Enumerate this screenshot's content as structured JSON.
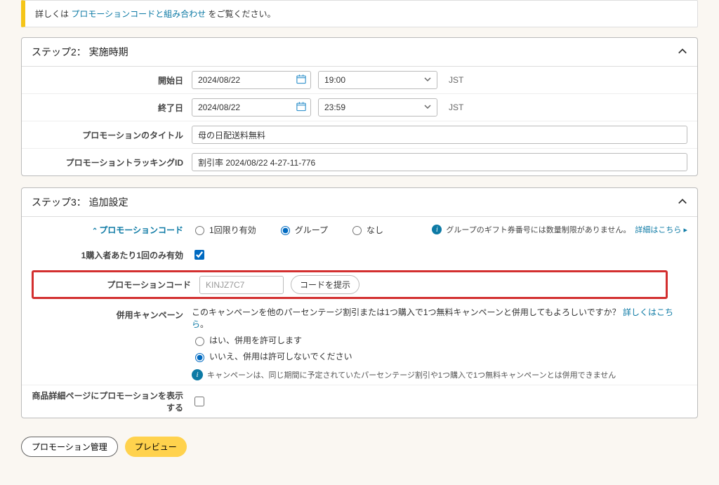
{
  "notice": {
    "prefix": "詳しくは ",
    "link": "プロモーションコードと組み合わせ",
    "suffix": " をご覧ください。"
  },
  "step2": {
    "title": "ステップ2： 実施時期",
    "rows": {
      "startDate": {
        "label": "開始日",
        "date": "2024/08/22",
        "time": "19:00",
        "tz": "JST"
      },
      "endDate": {
        "label": "終了日",
        "date": "2024/08/22",
        "time": "23:59",
        "tz": "JST"
      },
      "title": {
        "label": "プロモーションのタイトル",
        "value": "母の日配送料無料"
      },
      "trackingId": {
        "label": "プロモーショントラッキングID",
        "value": "割引率 2024/08/22 4-27-11-776"
      }
    }
  },
  "step3": {
    "title": "ステップ3： 追加設定",
    "promoCodeSection": {
      "label": "プロモーションコード",
      "options": {
        "once": "1回限り有効",
        "group": "グループ",
        "none": "なし"
      },
      "selected": "group",
      "infoText": "グループのギフト券番号には数量制限がありません。",
      "detailsLink": "詳細はこちら"
    },
    "onePerBuyer": {
      "label": "1購入者あたり1回のみ有効",
      "checked": true
    },
    "promoCode": {
      "label": "プロモーションコード",
      "value": "KINJZ7C7",
      "buttonLabel": "コードを提示"
    },
    "combine": {
      "label": "併用キャンペーン",
      "question": "このキャンペーンを他のパーセンテージ割引または1つ購入で1つ無料キャンペーンと併用してもよろしいですか？",
      "detailsLink": "詳しくはこちら",
      "options": {
        "yes": "はい、併用を許可します",
        "no": "いいえ、併用は許可しないでください"
      },
      "selected": "no",
      "note": "キャンペーンは、同じ期間に予定されていたパーセンテージ割引や1つ購入で1つ無料キャンペーンとは併用できません"
    },
    "showOnDetail": {
      "label": "商品詳細ページにプロモーションを表示する",
      "checked": false
    }
  },
  "buttons": {
    "manage": "プロモーション管理",
    "preview": "プレビュー"
  }
}
